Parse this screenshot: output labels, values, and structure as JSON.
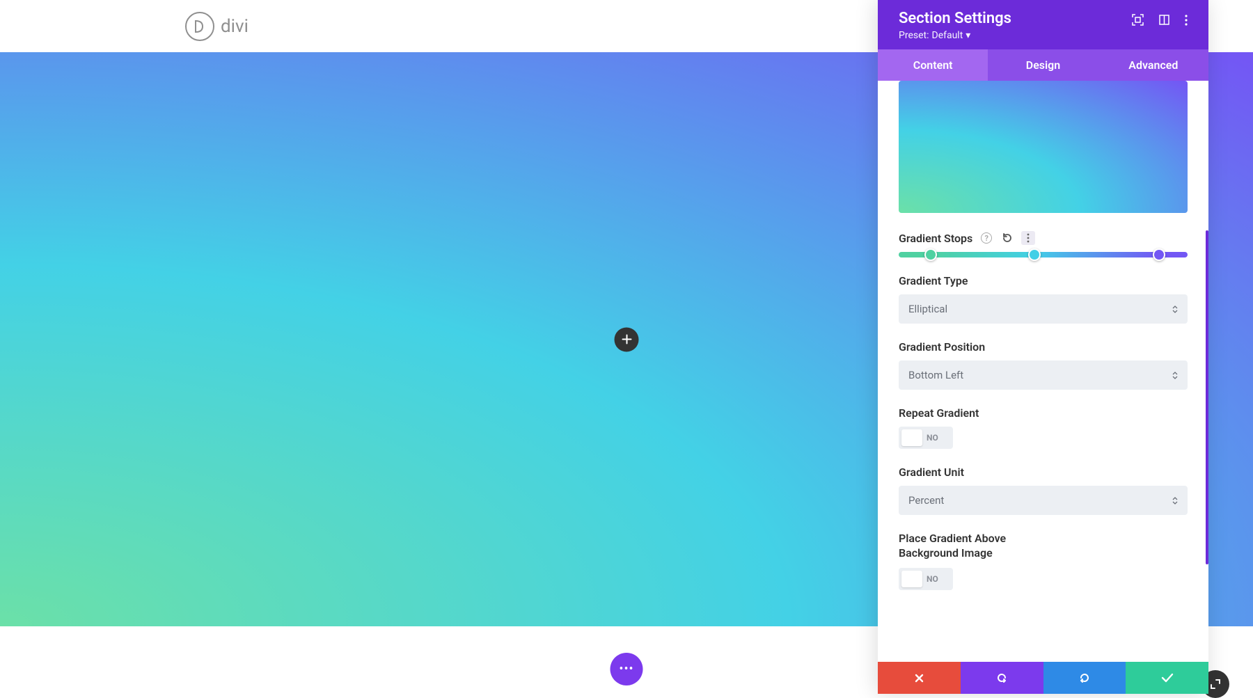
{
  "brand": "divi",
  "panel": {
    "title": "Section Settings",
    "preset_prefix": "Preset: ",
    "preset_value": "Default",
    "tabs": [
      "Content",
      "Design",
      "Advanced"
    ],
    "active_tab": 0
  },
  "controls": {
    "gradient_stops": {
      "label": "Gradient Stops",
      "stops": [
        {
          "pos": 11,
          "color": "#4fd1a1"
        },
        {
          "pos": 47,
          "color": "#42cfe6"
        },
        {
          "pos": 90,
          "color": "#7357f4"
        }
      ]
    },
    "gradient_type": {
      "label": "Gradient Type",
      "value": "Elliptical"
    },
    "gradient_position": {
      "label": "Gradient Position",
      "value": "Bottom Left"
    },
    "repeat_gradient": {
      "label": "Repeat Gradient",
      "value": "NO"
    },
    "gradient_unit": {
      "label": "Gradient Unit",
      "value": "Percent"
    },
    "place_above": {
      "label": "Place Gradient Above Background Image",
      "value": "NO"
    }
  },
  "colors": {
    "purple_header": "#6c2bd9",
    "purple_tab_bg": "#8b4ee8",
    "purple_tab_active": "#a367f0",
    "red": "#e74c3c",
    "blue": "#2e8ae6",
    "teal": "#2ecc9a",
    "fab": "#7c3aed"
  }
}
